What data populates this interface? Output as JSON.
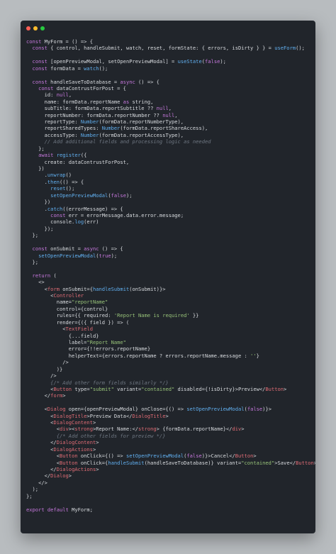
{
  "window": {
    "dots": [
      "close",
      "minimize",
      "maximize"
    ],
    "colors": {
      "background": "#21252b",
      "page": "#b8bcbf",
      "text": "#d7dade",
      "keyword": "#c678dd",
      "function": "#61afef",
      "string": "#98c379",
      "number": "#d19a66",
      "comment": "#6f7782",
      "tag": "#e06c75"
    }
  },
  "code": {
    "lines": [
      "const MyForm = () => {",
      "  const { control, handleSubmit, watch, reset, formState: { errors, isDirty } } = useForm();",
      "",
      "  const [openPreviewModal, setOpenPreviewModal] = useState(false);",
      "  const formData = watch();",
      "",
      "  const handleSaveToDatabase = async () => {",
      "    const dataContrustForPost = {",
      "      id: null,",
      "      name: formData.reportName as string,",
      "      subTitle: formData.reportSubtitle ?? null,",
      "      reportNumber: formData.reportNumber ?? null,",
      "      reportType: Number(formData.reportNumberType),",
      "      reportSharedTypes: Number(formData.reportShareAccess),",
      "      accessType: Number(formData.reportAccessType),",
      "      // Add additional fields and processing logic as needed",
      "    };",
      "    await register({",
      "      create: dataContrustForPost,",
      "    })",
      "      .unwrap()",
      "      .then(() => {",
      "        reset();",
      "        setOpenPreviewModal(false);",
      "      })",
      "      .catch((errorMessage) => {",
      "        const err = errorMessage.data.error.message;",
      "        console.log(err)",
      "      });",
      "  };",
      "",
      "  const onSubmit = async () => {",
      "    setOpenPreviewModal(true);",
      "  };",
      "",
      "  return (",
      "    <>",
      "      <form onSubmit={handleSubmit(onSubmit)}>",
      "        <Controller",
      "          name=\"reportName\"",
      "          control={control}",
      "          rules={{ required: 'Report Name is required' }}",
      "          render={({ field }) => (",
      "            <TextField",
      "              {...field}",
      "              label=\"Report Name\"",
      "              error={!!errors.reportName}",
      "              helperText={errors.reportName ? errors.reportName.message : ''}",
      "            />",
      "          )}",
      "        />",
      "        {/* Add other form fields similarly */}",
      "        <Button type=\"submit\" variant=\"contained\" disabled={!isDirty}>Preview</Button>",
      "      </form>",
      "",
      "      <Dialog open={openPreviewModal} onClose={() => setOpenPreviewModal(false)}>",
      "        <DialogTitle>Preview Data</DialogTitle>",
      "        <DialogContent>",
      "          <div><strong>Report Name:</strong> {formData.reportName}</div>",
      "          {/* Add other fields for preview */}",
      "        </DialogContent>",
      "        <DialogActions>",
      "          <Button onClick={() => setOpenPreviewModal(false)}>Cancel</Button>",
      "          <Button onClick={handleSubmit(handleSaveToDatabase)} variant=\"contained\">Save</Button>",
      "        </DialogActions>",
      "      </Dialog>",
      "    </>",
      "  );",
      "};",
      "",
      "export default MyForm;"
    ]
  }
}
